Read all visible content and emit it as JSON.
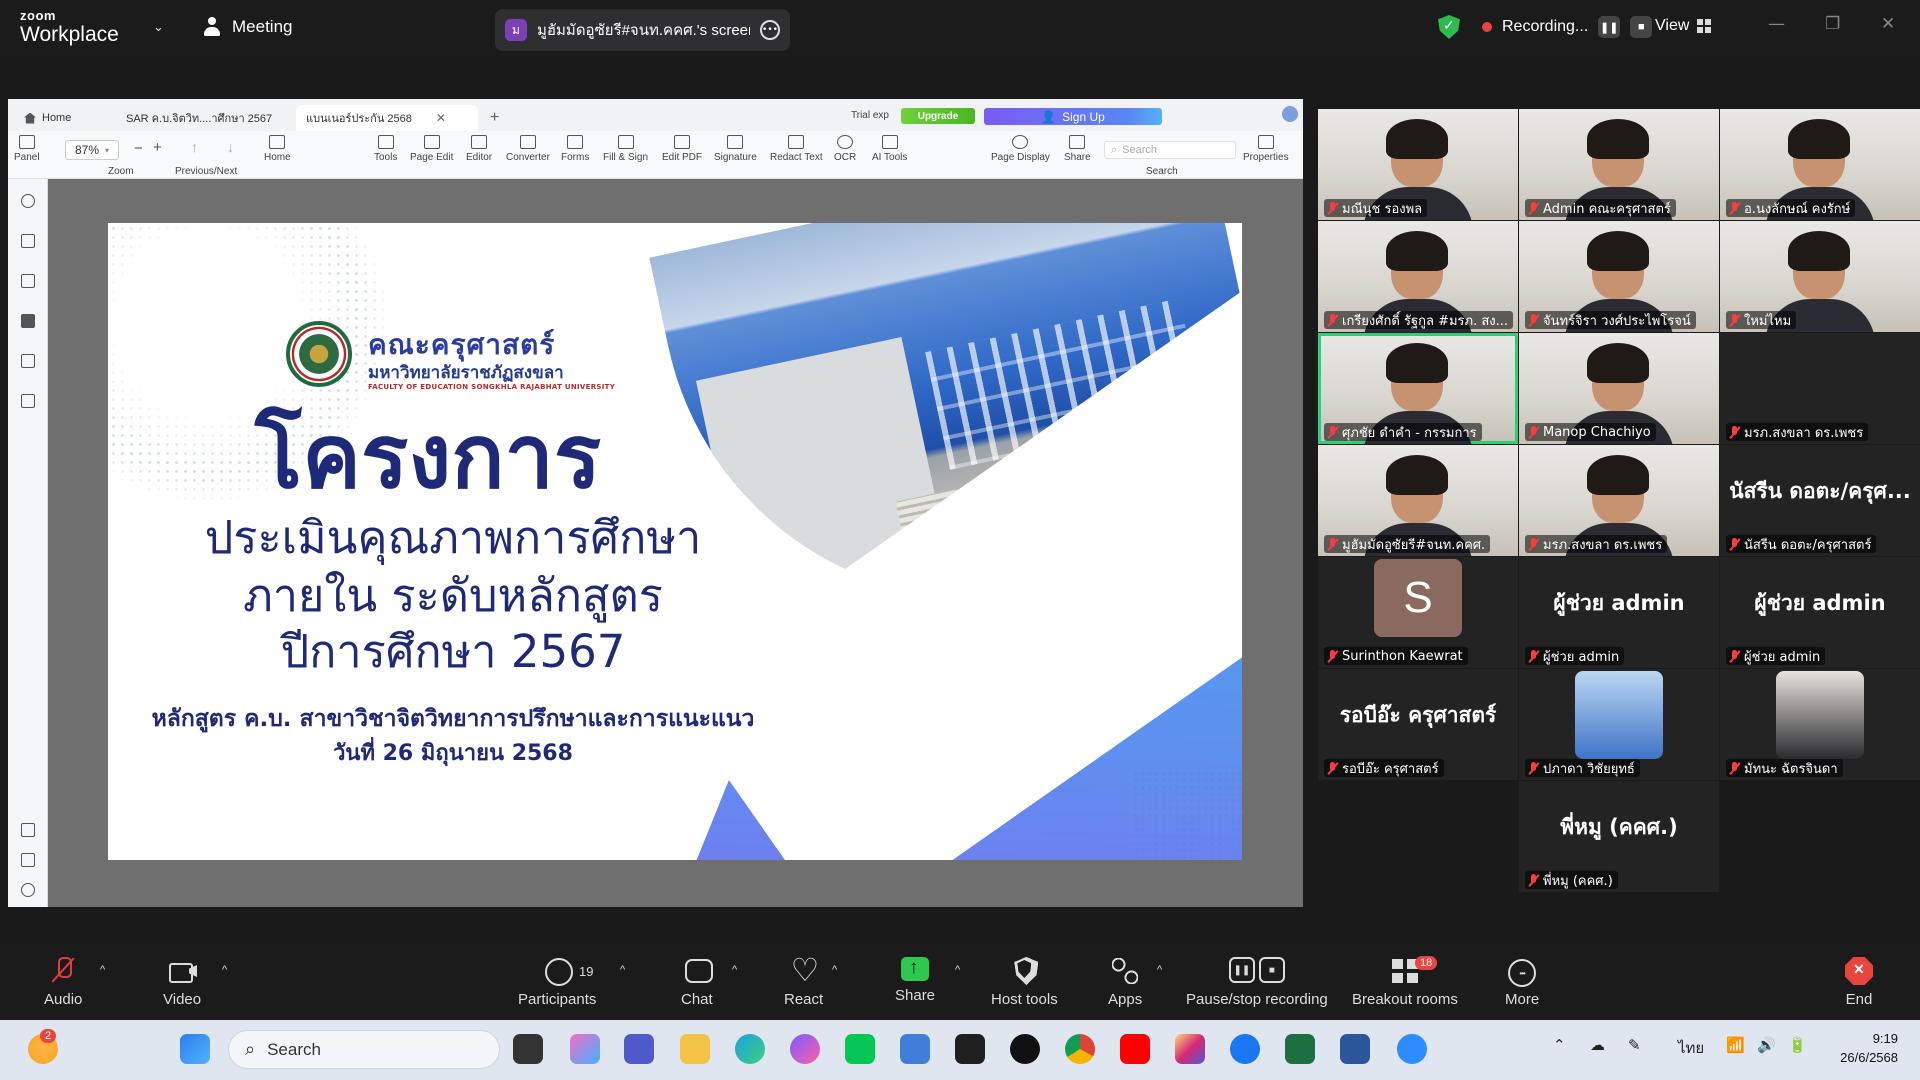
{
  "topbar": {
    "brand_top": "zoom",
    "brand_bottom": "Workplace",
    "meeting_label": "Meeting",
    "share_avatar": "ม",
    "share_title": "มูฮัมมัดอูซัยรี#จนท.คคศ.'s screen",
    "recording_label": "Recording...",
    "view_label": "View"
  },
  "viewer": {
    "tabs": [
      {
        "label": "Home"
      },
      {
        "label": "SAR ค.บ.จิตวิท....าศึกษา 2567"
      },
      {
        "label": "แบนเนอร์ประกัน 2568"
      }
    ],
    "trial_label": "Trial exp",
    "upgrade_label": "Upgrade",
    "signup_label": "Sign Up",
    "zoom_value": "87%",
    "tools": [
      "Panel",
      "Zoom",
      "Previous/Next",
      "Home",
      "Tools",
      "Page Edit",
      "Editor",
      "Converter",
      "Forms",
      "Fill & Sign",
      "Edit PDF",
      "Signature",
      "Redact Text",
      "OCR",
      "AI Tools",
      "Page Display",
      "Share",
      "Search",
      "Properties"
    ],
    "search_placeholder": "Search"
  },
  "slide": {
    "faculty_th": "คณะครุศาสตร์",
    "university_th": "มหาวิทยาลัยราชภัฏสงขลา",
    "university_en": "FACULTY OF EDUCATION SONGKHLA RAJABHAT UNIVERSITY",
    "title": "โครงการ",
    "line1": "ประเมินคุณภาพการศึกษา",
    "line2": "ภายใน ระดับหลักสูตร",
    "line3": "ปีการศึกษา 2567",
    "program": "หลักสูตร ค.บ. สาขาวิชาจิตวิทยาการปรึกษาและการแนะแนว",
    "date": "วันที่ 26 มิถุนายน 2568"
  },
  "gallery": {
    "tiles": [
      {
        "name": "มณีนุช รองพล",
        "type": "video"
      },
      {
        "name": "Admin คณะครุศาสตร์",
        "type": "video"
      },
      {
        "name": "อ.นงลักษณ์ คงรักษ์",
        "type": "video"
      },
      {
        "name": "เกรียงศักดิ์ รัฐกูล #มรภ. สง...",
        "type": "video"
      },
      {
        "name": "จันทร์จิรา วงศ์ประไพโรจน์",
        "type": "video"
      },
      {
        "name": "ใหม่ไหม",
        "type": "video"
      },
      {
        "name": "ศุภชัย ดำคำ - กรรมการ",
        "type": "video"
      },
      {
        "name": "Manop Chachiyo",
        "type": "video"
      },
      {
        "name": "มรภ.สงขลา ดร.เพชร",
        "type": "off"
      },
      {
        "name": "มูฮัมมัดอูซัยรี#จนท.คคศ.",
        "type": "video"
      },
      {
        "name": "มรภ.สงขลา ดร.เพชร",
        "type": "video"
      },
      {
        "name": "นัสรีน ดอตะ/ครุศาสตร์",
        "type": "text",
        "big": "นัสรีน ดอตะ/ครุศ..."
      },
      {
        "name": "Surinthon Kaewrat",
        "type": "avatar",
        "initial": "S"
      },
      {
        "name": "ผู้ช่วย admin",
        "type": "text",
        "big": "ผู้ช่วย admin"
      },
      {
        "name": "ผู้ช่วย admin",
        "type": "text",
        "big": "ผู้ช่วย admin"
      },
      {
        "name": "รอบีอ๊ะ ครุศาสตร์",
        "type": "text",
        "big": "รอบีอ๊ะ ครุศาสตร์"
      },
      {
        "name": "ปภาดา วิชัยยุทธ์",
        "type": "photo"
      },
      {
        "name": "มัทนะ ฉัตรจินดา",
        "type": "photo"
      },
      {
        "name": "พี่หมู (คคศ.)",
        "type": "text",
        "big": "พี่หมู (คคศ.)"
      }
    ]
  },
  "controls": {
    "audio": "Audio",
    "video": "Video",
    "participants": "Participants",
    "participants_count": "19",
    "chat": "Chat",
    "react": "React",
    "share": "Share",
    "host_tools": "Host tools",
    "apps": "Apps",
    "pause_stop": "Pause/stop recording",
    "breakout": "Breakout rooms",
    "breakout_badge": "18",
    "more": "More",
    "end": "End"
  },
  "taskbar": {
    "notif_badge": "2",
    "search_label": "Search",
    "lang": "ไทย",
    "time": "9:19",
    "date": "26/6/2568"
  },
  "colors": {
    "zoom_bg": "#1b1b1b",
    "recording_red": "#e8453c",
    "active_speaker": "#2ad17a",
    "slide_navy": "#1e2a78",
    "share_green": "#2dc84d"
  }
}
